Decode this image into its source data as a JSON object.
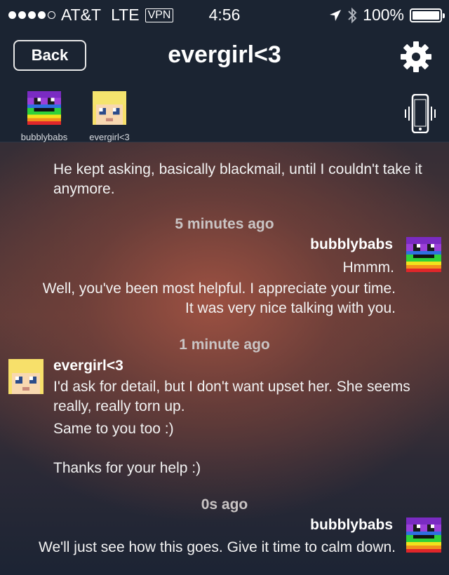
{
  "status_bar": {
    "carrier": "AT&T",
    "network": "LTE",
    "vpn": "VPN",
    "time": "4:56",
    "battery": "100%",
    "signal_bars_filled": 4,
    "signal_bars_total": 5
  },
  "nav": {
    "back_label": "Back",
    "title": "evergirl<3"
  },
  "participants": [
    {
      "name": "bubblybabs"
    },
    {
      "name": "evergirl<3"
    }
  ],
  "messages": {
    "m1": "He kept asking, basically blackmail, until I couldn't take it anymore.",
    "ts1": "5 minutes ago",
    "sender1": "bubblybabs",
    "m2": "Hmmm.",
    "m3": "Well, you've been most helpful.  I appreciate your time.  It was very nice talking with you.",
    "ts2": "1 minute ago",
    "sender2": "evergirl<3",
    "m4": "I'd ask for detail, but I don't want upset her. She seems really, really torn up.",
    "m5": "Same to you too :)",
    "m6": "Thanks for your help :)",
    "ts3": "0s ago",
    "sender3": "bubblybabs",
    "m7": "We'll just see how this goes.  Give it time to calm down."
  },
  "colors": {
    "nav_bg": "#1b2432",
    "text": "#f2f2f2",
    "timestamp": "#c9c4c4"
  },
  "icons": {
    "settings": "gear-icon",
    "device": "phone-vibrate-icon"
  }
}
